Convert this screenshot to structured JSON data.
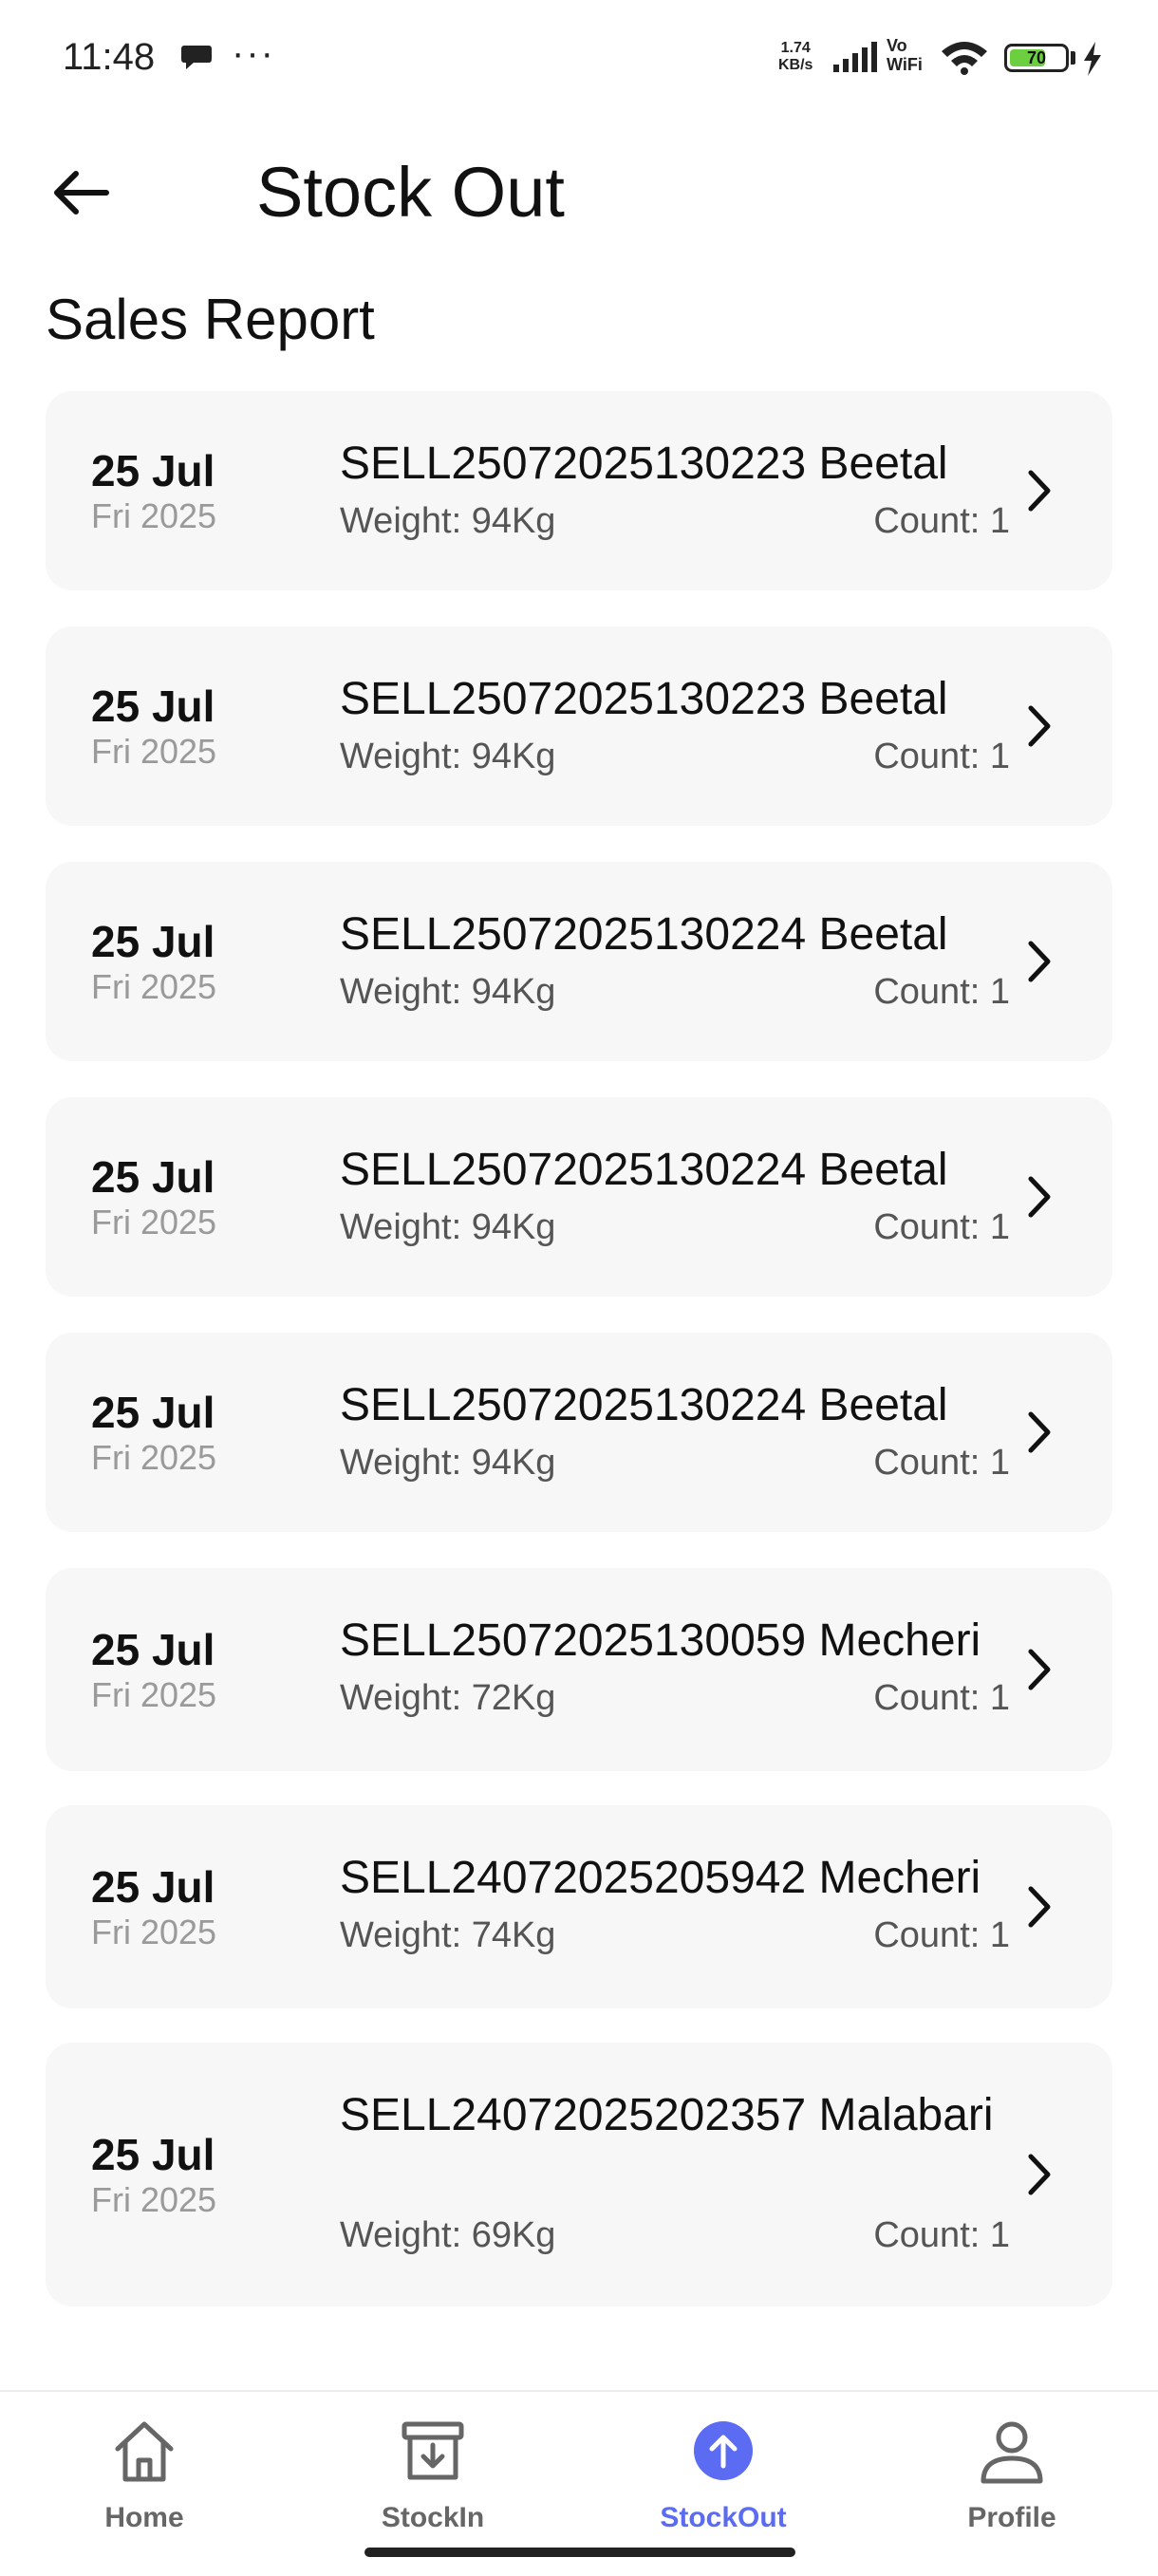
{
  "status": {
    "time": "11:48",
    "net_speed_value": "1.74",
    "net_speed_unit": "KB/s",
    "vo_top": "Vo",
    "vo_bottom": "WiFi",
    "battery": "70",
    "battery_level": 0.7
  },
  "header": {
    "title": "Stock Out"
  },
  "section": {
    "title": "Sales Report"
  },
  "items": [
    {
      "day": "25 Jul",
      "sub": "Fri 2025",
      "title": "SELL25072025130223 Beetal",
      "weight": "Weight: 94Kg",
      "count": "Count: 1"
    },
    {
      "day": "25 Jul",
      "sub": "Fri 2025",
      "title": "SELL25072025130223 Beetal",
      "weight": "Weight: 94Kg",
      "count": "Count: 1"
    },
    {
      "day": "25 Jul",
      "sub": "Fri 2025",
      "title": "SELL25072025130224 Beetal",
      "weight": "Weight: 94Kg",
      "count": "Count: 1"
    },
    {
      "day": "25 Jul",
      "sub": "Fri 2025",
      "title": "SELL25072025130224 Beetal",
      "weight": "Weight: 94Kg",
      "count": "Count: 1"
    },
    {
      "day": "25 Jul",
      "sub": "Fri 2025",
      "title": "SELL25072025130224 Beetal",
      "weight": "Weight: 94Kg",
      "count": "Count: 1"
    },
    {
      "day": "25 Jul",
      "sub": "Fri 2025",
      "title": "SELL25072025130059 Mecheri",
      "weight": "Weight: 72Kg",
      "count": "Count: 1"
    },
    {
      "day": "25 Jul",
      "sub": "Fri 2025",
      "title": "SELL24072025205942 Mecheri",
      "weight": "Weight: 74Kg",
      "count": "Count: 1"
    },
    {
      "day": "25 Jul",
      "sub": "Fri 2025",
      "title": "SELL24072025202357 Malabari",
      "weight": "Weight: 69Kg",
      "count": "Count: 1"
    }
  ],
  "nav": {
    "home": "Home",
    "stockin": "StockIn",
    "stockout": "StockOut",
    "profile": "Profile",
    "active_color": "#5b6cf2"
  }
}
